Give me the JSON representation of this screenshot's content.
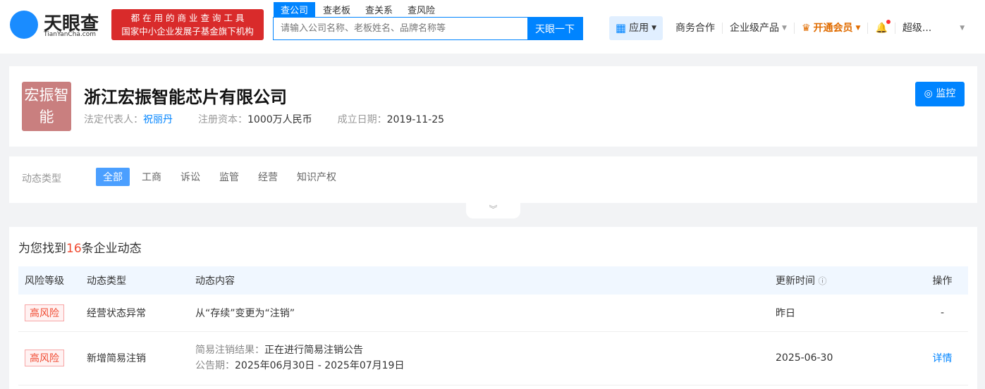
{
  "header": {
    "logo": "天眼查",
    "logo_sub": "TianYanCha.com",
    "slogan1": "都 在 用 的 商 业 查 询 工 具",
    "slogan2": "国家中小企业发展子基金旗下机构",
    "search_tabs": [
      "查公司",
      "查老板",
      "查关系",
      "查风险"
    ],
    "search_placeholder": "请输入公司名称、老板姓名、品牌名称等",
    "search_button": "天眼一下",
    "nav": {
      "apps": "应用",
      "business": "商务合作",
      "enterprise": "企业级产品",
      "vip": "开通会员",
      "user": "超级..."
    }
  },
  "company": {
    "logo_text": "宏振智能",
    "name": "浙江宏振智能芯片有限公司",
    "legal_rep_label": "法定代表人：",
    "legal_rep": "祝丽丹",
    "capital_label": "注册资本：",
    "capital": "1000万人民币",
    "founded_label": "成立日期：",
    "founded": "2019-11-25",
    "monitor": "监控"
  },
  "filter": {
    "label": "动态类型",
    "tabs": [
      "全部",
      "工商",
      "诉讼",
      "监管",
      "经营",
      "知识产权"
    ]
  },
  "results": {
    "prefix": "为您找到",
    "count": "16",
    "suffix": "条企业动态",
    "columns": [
      "风险等级",
      "动态类型",
      "动态内容",
      "更新时间",
      "操作"
    ],
    "rows": [
      {
        "risk": "高风险",
        "type": "经营状态异常",
        "content": "从“存续”变更为“注销”",
        "time": "昨日",
        "action": "-"
      },
      {
        "risk": "高风险",
        "type": "新增简易注销",
        "content_label1": "简易注销结果：",
        "content1": "正在进行简易注销公告",
        "content_label2": "公告期：",
        "content2": "2025年06月30日 - 2025年07月19日",
        "time": "2025-06-30",
        "action": "详情"
      }
    ]
  }
}
